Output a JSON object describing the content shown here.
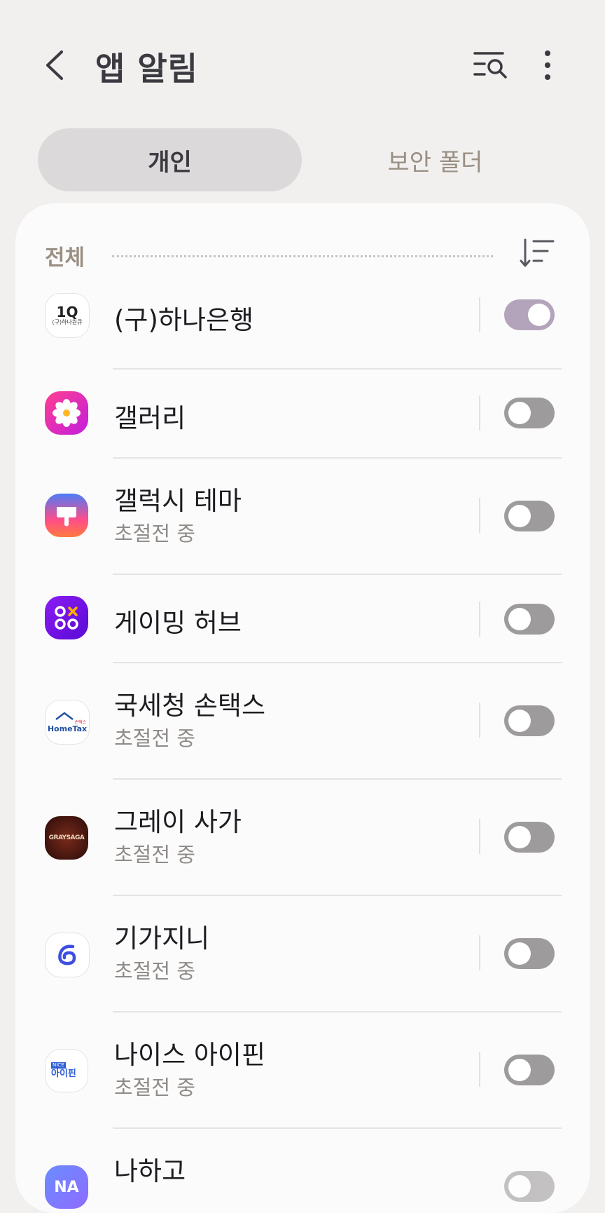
{
  "header": {
    "title": "앱 알림"
  },
  "tabs": [
    {
      "label": "개인",
      "active": true
    },
    {
      "label": "보안 폴더",
      "active": false
    }
  ],
  "section": {
    "label": "전체"
  },
  "apps": [
    {
      "name": "(구)하나은행",
      "sub": "",
      "enabled": true,
      "icon": "hana-bank-icon",
      "icon_text": "1Q",
      "icon_sub": "(구)하나원큐"
    },
    {
      "name": "갤러리",
      "sub": "",
      "enabled": false,
      "icon": "gallery-flower-icon"
    },
    {
      "name": "갤럭시 테마",
      "sub": "초절전 중",
      "enabled": false,
      "icon": "galaxy-themes-brush-icon"
    },
    {
      "name": "게이밍 허브",
      "sub": "",
      "enabled": false,
      "icon": "gaming-hub-icon"
    },
    {
      "name": "국세청 손택스",
      "sub": "초절전 중",
      "enabled": false,
      "icon": "hometax-icon",
      "icon_text": "HomeTax",
      "icon_badge": "손택스"
    },
    {
      "name": "그레이 사가",
      "sub": "초절전 중",
      "enabled": false,
      "icon": "gray-saga-icon",
      "icon_text": "GRAYSAGA"
    },
    {
      "name": "기가지니",
      "sub": "초절전 중",
      "enabled": false,
      "icon": "gigagenie-icon"
    },
    {
      "name": "나이스 아이핀",
      "sub": "초절전 중",
      "enabled": false,
      "icon": "nice-ipin-icon",
      "icon_text": "아이핀",
      "icon_badge": "NICE"
    },
    {
      "name": "나하고",
      "sub": "",
      "enabled": false,
      "icon": "nahago-icon",
      "icon_text": "NA"
    }
  ],
  "colors": {
    "background": "#f2f0ef",
    "card": "#fcfbfb",
    "toggle_on": "#b3a3bb",
    "toggle_off": "#9d9b9c"
  }
}
